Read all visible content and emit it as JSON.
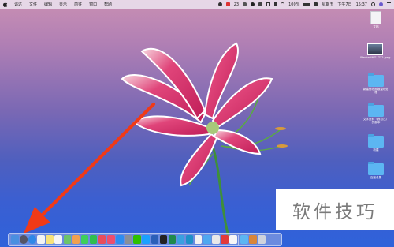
{
  "menubar": {
    "items": [
      "访达",
      "文件",
      "编辑",
      "显示",
      "前往",
      "窗口",
      "帮助"
    ],
    "status": [
      "23",
      "100%",
      "星期五",
      "下午7日",
      "15:37"
    ]
  },
  "desktop": {
    "items": [
      {
        "label": "文档",
        "kind": "doc"
      },
      {
        "label": "WechatIMG1712.jpeg",
        "kind": "thumb"
      },
      {
        "label": "新建修改图版整理处理",
        "kind": "folder"
      },
      {
        "label": "文字资料（我自己）的副本",
        "kind": "folder"
      },
      {
        "label": "新建",
        "kind": "folder"
      },
      {
        "label": "百度总集",
        "kind": "folder"
      }
    ]
  },
  "watermark": {
    "text": "软件技巧"
  },
  "dock": {
    "apps": [
      {
        "icon": "finder-icon",
        "color": "#4a8fe0"
      },
      {
        "icon": "launchpad-icon",
        "color": "#555566"
      },
      {
        "icon": "safari-icon",
        "color": "#2e88e8"
      },
      {
        "icon": "calendar-icon",
        "color": "#f3f3f3"
      },
      {
        "icon": "notes-icon",
        "color": "#f7e27a"
      },
      {
        "icon": "reminders-icon",
        "color": "#f5f5f5"
      },
      {
        "icon": "maps-icon",
        "color": "#6cc46a"
      },
      {
        "icon": "photos-icon",
        "color": "#f0a050"
      },
      {
        "icon": "messages-icon",
        "color": "#3ecf5a"
      },
      {
        "icon": "facetime-icon",
        "color": "#2fbe4f"
      },
      {
        "icon": "news-icon",
        "color": "#e84d5c"
      },
      {
        "icon": "music-icon",
        "color": "#ee4e6e"
      },
      {
        "icon": "appstore-icon",
        "color": "#2d8cf0"
      },
      {
        "icon": "preferences-icon",
        "color": "#8a8f98"
      },
      {
        "icon": "wechat-icon",
        "color": "#2dc100"
      },
      {
        "icon": "qq-icon",
        "color": "#1aa1ff"
      },
      {
        "icon": "word-icon",
        "color": "#2b5fb8"
      },
      {
        "icon": "terminal-icon",
        "color": "#222222"
      },
      {
        "icon": "excel-icon",
        "color": "#1f8a4c"
      },
      {
        "icon": "app-icon",
        "color": "#3aa0e0"
      },
      {
        "icon": "app-icon-2",
        "color": "#1e90c8"
      },
      {
        "icon": "app-icon-3",
        "color": "#f2f2f2"
      },
      {
        "icon": "paperplane-icon",
        "color": "#4fa8f0"
      },
      {
        "icon": "app-icon-4",
        "color": "#e8e8e8"
      },
      {
        "icon": "wps-icon",
        "color": "#e23a3a"
      },
      {
        "icon": "app-icon-5",
        "color": "#f6f6f6"
      },
      {
        "icon": "folder-icon",
        "color": "#5cb6f2"
      },
      {
        "icon": "settings-icon",
        "color": "#d8863a"
      },
      {
        "icon": "trash-icon",
        "color": "#cfd3dc"
      }
    ]
  }
}
